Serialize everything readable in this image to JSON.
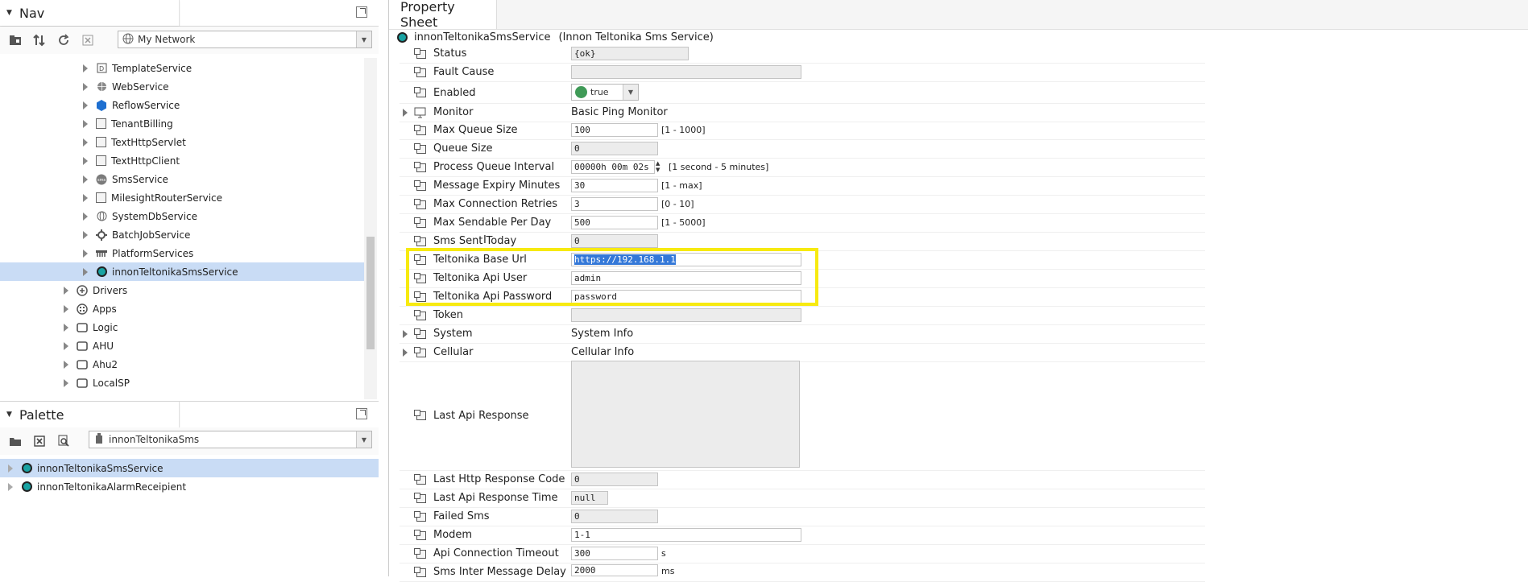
{
  "nav": {
    "title": "Nav",
    "network_combo": "My Network",
    "tree": [
      {
        "label": "TemplateService",
        "icon": "template-icon"
      },
      {
        "label": "WebService",
        "icon": "globe-icon"
      },
      {
        "label": "ReflowService",
        "icon": "hexagon-icon"
      },
      {
        "label": "TenantBilling",
        "icon": "cube-icon"
      },
      {
        "label": "TextHttpServlet",
        "icon": "cube-icon"
      },
      {
        "label": "TextHttpClient",
        "icon": "cube-icon"
      },
      {
        "label": "SmsService",
        "icon": "sms-icon"
      },
      {
        "label": "MilesightRouterService",
        "icon": "cube-icon"
      },
      {
        "label": "SystemDbService",
        "icon": "globe-icon"
      },
      {
        "label": "BatchJobService",
        "icon": "gear-icon"
      },
      {
        "label": "PlatformServices",
        "icon": "platform-icon"
      },
      {
        "label": "innonTeltonikaSmsService",
        "icon": "service-dot-icon"
      },
      {
        "label": "Drivers",
        "icon": "drivers-icon"
      },
      {
        "label": "Apps",
        "icon": "apps-icon"
      },
      {
        "label": "Logic",
        "icon": "folder-icon"
      },
      {
        "label": "AHU",
        "icon": "folder-icon"
      },
      {
        "label": "Ahu2",
        "icon": "folder-icon"
      },
      {
        "label": "LocalSP",
        "icon": "folder-icon"
      }
    ]
  },
  "palette": {
    "title": "Palette",
    "module_combo": "innonTeltonikaSms",
    "items": [
      {
        "label": "innonTeltonikaSmsService"
      },
      {
        "label": "innonTeltonikaAlarmReceipient"
      }
    ]
  },
  "property_sheet": {
    "tab_label": "Property Sheet",
    "component_name": "innonTeltonikaSmsService",
    "component_type": "(Innon Teltonika Sms Service)",
    "rows": [
      {
        "label": "Status",
        "value": "{ok}"
      },
      {
        "label": "Fault Cause",
        "value": ""
      },
      {
        "label": "Enabled",
        "value": "true"
      },
      {
        "label": "Monitor",
        "value": "Basic Ping Monitor"
      },
      {
        "label": "Max Queue Size",
        "value": "100",
        "range": "[1 - 1000]"
      },
      {
        "label": "Queue Size",
        "value": "0"
      },
      {
        "label": "Process Queue Interval",
        "value": "00000h 00m 02s",
        "range": "[1 second - 5 minutes]"
      },
      {
        "label": "Message Expiry Minutes",
        "value": "30",
        "range": "[1 - max]"
      },
      {
        "label": "Max Connection Retries",
        "value": "3",
        "range": "[0 - 10]"
      },
      {
        "label": "Max Sendable Per Day",
        "value": "500",
        "range": "[1 - 5000]"
      },
      {
        "label": "Sms Sent Today",
        "value": "0"
      },
      {
        "label": "Teltonika Base Url",
        "value": "https://192.168.1.1"
      },
      {
        "label": "Teltonika Api User",
        "value": "admin"
      },
      {
        "label": "Teltonika Api Password",
        "value": "password"
      },
      {
        "label": "Token",
        "value": ""
      },
      {
        "label": "System",
        "value": "System Info"
      },
      {
        "label": "Cellular",
        "value": "Cellular Info"
      },
      {
        "label": "Last Api Response",
        "value": ""
      },
      {
        "label": "Last Http Response Code",
        "value": "0"
      },
      {
        "label": "Last Api Response Time",
        "value": "null"
      },
      {
        "label": "Failed Sms",
        "value": "0"
      },
      {
        "label": "Modem",
        "value": "1-1"
      },
      {
        "label": "Api Connection Timeout",
        "value": "300",
        "unit": "s"
      },
      {
        "label": "Sms Inter Message Delay",
        "value": "2000",
        "unit": "ms"
      }
    ]
  },
  "colors": {
    "selection": "#c9dcf5",
    "highlight_box": "#f7ea10",
    "enabled_dot": "#3f9a57",
    "service_dot": "#19a3a3"
  }
}
